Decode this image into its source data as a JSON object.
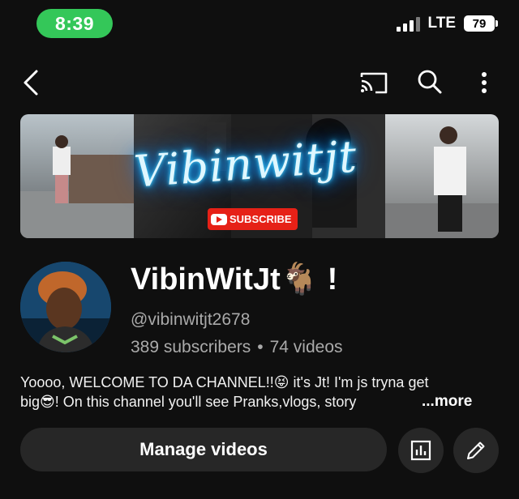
{
  "status_bar": {
    "time": "8:39",
    "network": "LTE",
    "battery": "79"
  },
  "top_bar": {
    "icons": [
      "back-arrow-icon",
      "cast-icon",
      "search-icon",
      "more-vert-icon"
    ]
  },
  "banner": {
    "title": "Vibinwitjt",
    "subscribe_label": "SUBSCRIBE"
  },
  "channel": {
    "name": "VibinWitJt🐐 !",
    "handle": "@vibinwitjt2678",
    "subscribers": "389 subscribers",
    "separator": "•",
    "videos": "74 videos"
  },
  "description": {
    "line1": "Yoooo, WELCOME TO DA CHANNEL!!😝  it's Jt! I'm  js tryna get",
    "line2": "big😎! On this channel you'll see Pranks,vlogs, story",
    "more_label": "...more"
  },
  "actions": {
    "manage_videos_label": "Manage videos"
  },
  "colors": {
    "background": "#0f0f0f",
    "time_pill": "#34c759",
    "button_bg": "#272727",
    "secondary_text": "#aaaaaa",
    "subscribe_red": "#e62117"
  }
}
